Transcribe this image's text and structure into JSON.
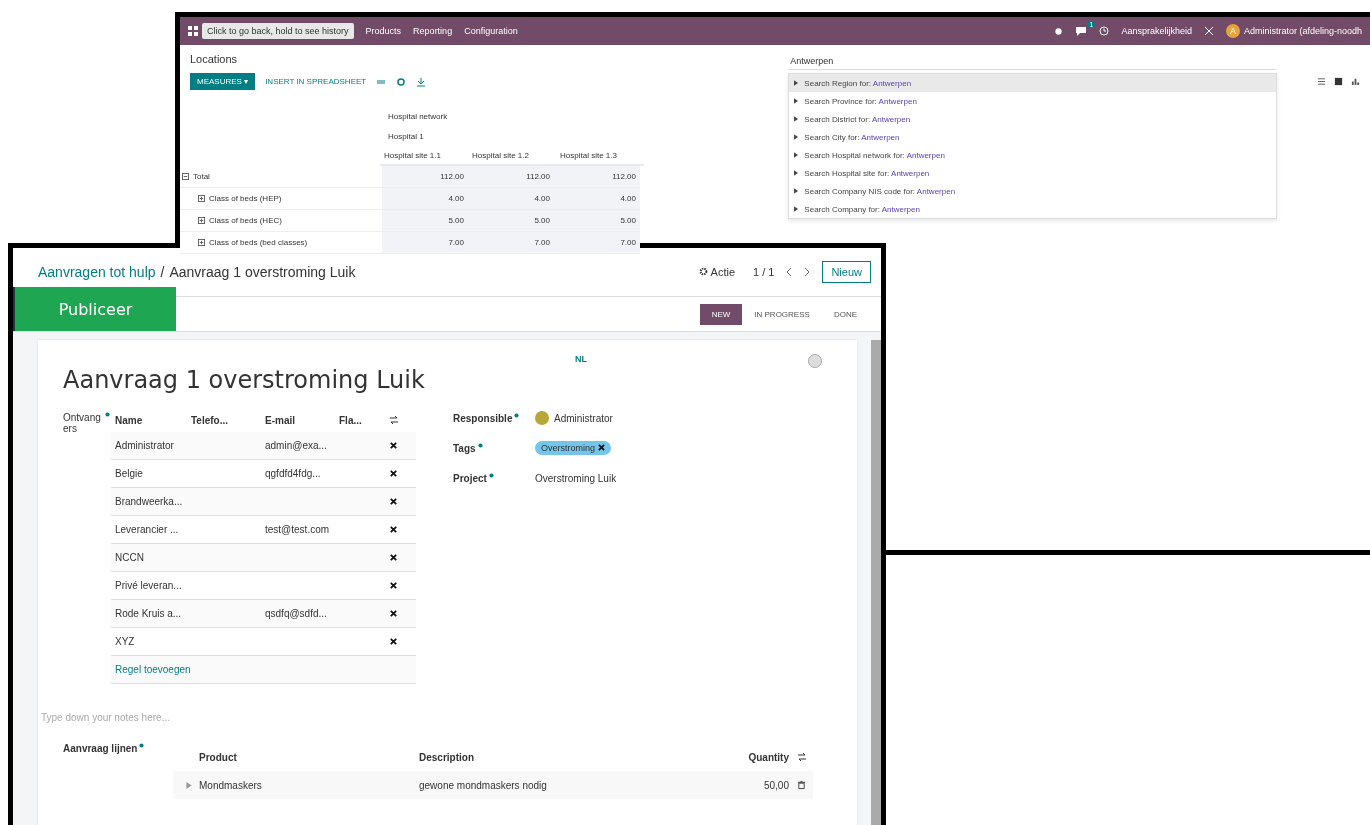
{
  "back_window": {
    "navbar": {
      "tooltip": "Click to go back, hold to see history",
      "menu": [
        "Products",
        "Reporting",
        "Configuration"
      ],
      "chat_badge": "1",
      "company": "Aansprakelijkheid",
      "user_initial": "A",
      "user": "Administrator (afdeling-noodh"
    },
    "title": "Locations",
    "buttons": [
      {
        "label": "MEASURES ▾",
        "kind": "primary"
      },
      {
        "label": "INSERT IN SPREADSHEET",
        "kind": "link"
      }
    ],
    "search": {
      "value": "Antwerpen"
    },
    "suggestions": [
      {
        "prefix": "Search Region for:",
        "term": "Antwerpen",
        "selected": true
      },
      {
        "prefix": "Search Province for:",
        "term": "Antwerpen",
        "selected": false
      },
      {
        "prefix": "Search District for:",
        "term": "Antwerpen",
        "selected": false
      },
      {
        "prefix": "Search City for:",
        "term": "Antwerpen",
        "selected": false
      },
      {
        "prefix": "Search Hospital network for:",
        "term": "Antwerpen",
        "selected": false
      },
      {
        "prefix": "Search Hospital site for:",
        "term": "Antwerpen",
        "selected": false
      },
      {
        "prefix": "Search Company NIS code for:",
        "term": "Antwerpen",
        "selected": false
      },
      {
        "prefix": "Search Company for:",
        "term": "Antwerpen",
        "selected": false
      }
    ],
    "pivot": {
      "header_1": "Hospital network",
      "header_2": "Hospital 1",
      "columns": [
        "Hospital site 1.1",
        "Hospital site 1.2",
        "Hospital site 1.3"
      ],
      "rows": [
        {
          "label": "Total",
          "kind": "total",
          "values": [
            "112.00",
            "112.00",
            "112.00"
          ]
        },
        {
          "label": "Class of beds (HEP)",
          "kind": "sub",
          "values": [
            "4.00",
            "4.00",
            "4.00"
          ]
        },
        {
          "label": "Class of beds (HEC)",
          "kind": "sub",
          "values": [
            "5.00",
            "5.00",
            "5.00"
          ]
        },
        {
          "label": "Class of beds (bed classes)",
          "kind": "sub",
          "values": [
            "7.00",
            "7.00",
            "7.00"
          ]
        }
      ]
    }
  },
  "front_window": {
    "breadcrumb": {
      "parent": "Aanvragen tot hulp",
      "separator": "/",
      "current": "Aanvraag 1 overstroming Luik"
    },
    "action": "Actie",
    "pager": "1 / 1",
    "new_button": "Nieuw",
    "publish_button": "Publiceer",
    "stages": [
      {
        "label": "NEW",
        "selected": true
      },
      {
        "label": "IN PROGRESS",
        "selected": false
      },
      {
        "label": "DONE",
        "selected": false
      }
    ],
    "title": "Aanvraag 1 overstroming Luik",
    "language": "NL",
    "recipients": {
      "label": "Ontvangers",
      "columns": [
        "Name",
        "Telefo...",
        "E-mail",
        "Fla..."
      ],
      "rows": [
        {
          "name": "Administrator",
          "email": "admin@exa..."
        },
        {
          "name": "Belgie",
          "email": "qgfdfd4fdg..."
        },
        {
          "name": "Brandweerka...",
          "email": ""
        },
        {
          "name": "Leverancier ...",
          "email": "test@test.com"
        },
        {
          "name": "NCCN",
          "email": ""
        },
        {
          "name": "Privé leveran...",
          "email": ""
        },
        {
          "name": "Rode Kruis a...",
          "email": "qsdfq@sdfd..."
        },
        {
          "name": "XYZ",
          "email": ""
        }
      ],
      "add_line": "Regel toevoegen"
    },
    "fields": [
      {
        "label": "Responsible",
        "value": "Administrator",
        "kind": "user"
      },
      {
        "label": "Tags",
        "value": "Overstroming",
        "kind": "tag"
      },
      {
        "label": "Project",
        "value": "Overstroming Luik",
        "kind": "text"
      }
    ],
    "notes_placeholder": "Type down your notes here...",
    "lines": {
      "label": "Aanvraag lijnen",
      "columns": [
        "Product",
        "Description",
        "Quantity"
      ],
      "rows": [
        {
          "product": "Mondmaskers",
          "description": "gewone mondmaskers nodig",
          "quantity": "50,00"
        }
      ]
    }
  }
}
